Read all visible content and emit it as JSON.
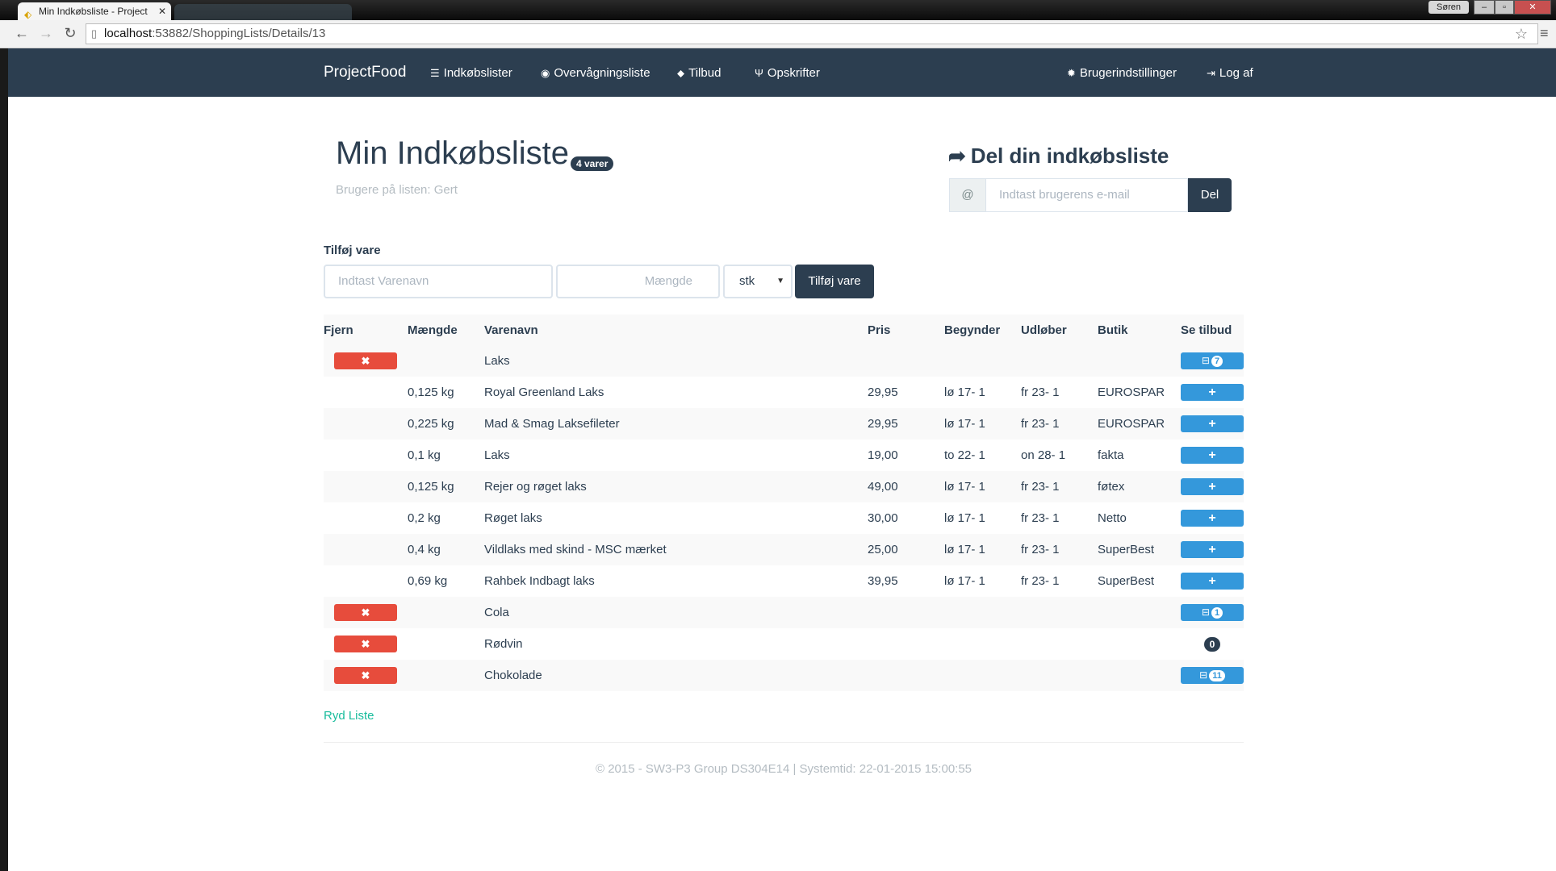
{
  "browser": {
    "tab_title": "Min Indkøbsliste - Project",
    "user_chip": "Søren",
    "url_host": "localhost",
    "url_path": ":53882/ShoppingLists/Details/13"
  },
  "navbar": {
    "brand": "ProjectFood",
    "items": [
      {
        "icon": "☰",
        "label": "Indkøbslister"
      },
      {
        "icon": "◉",
        "label": "Overvågningsliste"
      },
      {
        "icon": "⬥",
        "label": "Tilbud"
      },
      {
        "icon": "Ψ",
        "label": "Opskrifter"
      }
    ],
    "right_items": [
      {
        "icon": "✹",
        "label": "Brugerindstillinger"
      },
      {
        "icon": "⇥",
        "label": "Log af"
      }
    ]
  },
  "header": {
    "title": "Min Indkøbsliste",
    "count_badge": "4 varer",
    "users_text": "Brugere på listen: Gert"
  },
  "share": {
    "title": "Del din indkøbsliste",
    "addon": "@",
    "email_placeholder": "Indtast brugerens e-mail",
    "button": "Del"
  },
  "add_item": {
    "label": "Tilføj vare",
    "name_placeholder": "Indtast Varenavn",
    "amount_placeholder": "Mængde",
    "unit_selected": "stk",
    "button": "Tilføj vare"
  },
  "table": {
    "columns": [
      "Fjern",
      "Mængde",
      "Varenavn",
      "Pris",
      "Begynder",
      "Udløber",
      "Butik",
      "Se tilbud"
    ],
    "rows": [
      {
        "kind": "item",
        "name": "Laks",
        "offers": "7"
      },
      {
        "kind": "offer",
        "amount": "0,125 kg",
        "name": "Royal Greenland Laks",
        "price": "29,95",
        "start": "lø 17- 1",
        "end": "fr 23- 1",
        "store": "EUROSPAR"
      },
      {
        "kind": "offer",
        "amount": "0,225 kg",
        "name": "Mad & Smag Laksefileter",
        "price": "29,95",
        "start": "lø 17- 1",
        "end": "fr 23- 1",
        "store": "EUROSPAR"
      },
      {
        "kind": "offer",
        "amount": "0,1 kg",
        "name": "Laks",
        "price": "19,00",
        "start": "to 22- 1",
        "end": "on 28- 1",
        "store": "fakta"
      },
      {
        "kind": "offer",
        "amount": "0,125 kg",
        "name": "Rejer og røget laks",
        "price": "49,00",
        "start": "lø 17- 1",
        "end": "fr 23- 1",
        "store": "føtex"
      },
      {
        "kind": "offer",
        "amount": "0,2 kg",
        "name": "Røget laks",
        "price": "30,00",
        "start": "lø 17- 1",
        "end": "fr 23- 1",
        "store": "Netto"
      },
      {
        "kind": "offer",
        "amount": "0,4 kg",
        "name": "Vildlaks med skind - MSC mærket",
        "price": "25,00",
        "start": "lø 17- 1",
        "end": "fr 23- 1",
        "store": "SuperBest"
      },
      {
        "kind": "offer",
        "amount": "0,69 kg",
        "name": "Rahbek Indbagt laks",
        "price": "39,95",
        "start": "lø 17- 1",
        "end": "fr 23- 1",
        "store": "SuperBest"
      },
      {
        "kind": "item",
        "name": "Cola",
        "offers": "1"
      },
      {
        "kind": "item-zero",
        "name": "Rødvin",
        "offers": "0"
      },
      {
        "kind": "item",
        "name": "Chokolade",
        "offers": "11"
      }
    ]
  },
  "clear_link": "Ryd Liste",
  "footer": "© 2015 - SW3-P3 Group DS304E14 | Systemtid: 22-01-2015 15:00:55",
  "colors": {
    "navbar": "#2c3e50",
    "danger": "#e74c3c",
    "info": "#3498db",
    "link": "#18bc9c"
  }
}
